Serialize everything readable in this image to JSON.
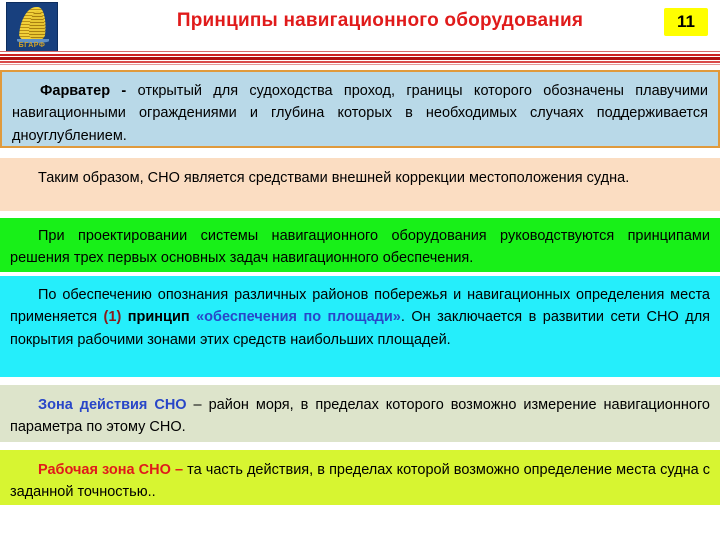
{
  "header": {
    "title": "Принципы  навигационного оборудования",
    "page_number": "11",
    "logo_text": "БГАРФ",
    "title_color": "#e01b1b",
    "badge_bg": "#ffff00"
  },
  "blocks": {
    "fairway": {
      "lead": "Фарватер -",
      "text": " открытый для судоходства проход, границы которого обозначены плавучими навигационными ограждениями и глубина которых в необходимых случаях поддерживается дноуглублением.",
      "bg": "#b9d9e8",
      "border": "#e09a3c"
    },
    "thus": {
      "text": "Таким образом, СНО является средствами внешней коррекции местоположения судна.",
      "bg": "#fbddc2"
    },
    "design": {
      "text": "При проектировании системы навигационного оборудования руководствуются принципами решения трех первых основных задач навигационного обеспечения.",
      "bg": "#18f018"
    },
    "area": {
      "part1": "По обеспечению опознания различных районов побережья и навигационных определения места применяется ",
      "marker": "(1)",
      "part2": " принцип ",
      "quoted": "«обеспечения по площади»",
      "part3": ". Он заключается в развитии сети СНО для покрытия рабочими зонами этих средств наибольших площадей.",
      "bg": "#25eefb"
    },
    "zone": {
      "lead": "Зона действия СНО",
      "text": " – район моря, в пределах которого возможно измерение навигационного параметра по этому СНО.",
      "bg": "#dde4cb"
    },
    "work": {
      "lead": "Рабочая зона СНО –",
      "text": "  та часть действия, в пределах которой возможно определение места судна с заданной точностью..",
      "bg": "#d7f531"
    }
  }
}
